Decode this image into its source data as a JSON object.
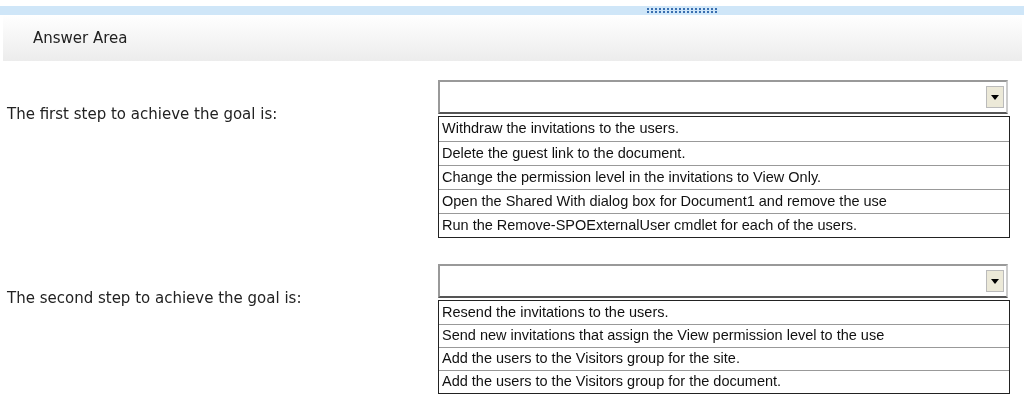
{
  "header": {
    "title": "Answer Area"
  },
  "questions": [
    {
      "label": "The first step to achieve the goal is:",
      "options": [
        "Withdraw the invitations to the users.",
        "Delete the guest link to the document.",
        "Change the permission level in the invitations to View Only.",
        "Open the Shared With dialog box for Document1 and remove the use",
        "Run the Remove-SPOExternalUser cmdlet for each of the users."
      ]
    },
    {
      "label": "The second step to achieve the goal is:",
      "options": [
        "Resend the invitations to the users.",
        "Send new invitations that assign the View permission level to the use",
        "Add the users to the Visitors group for the site.",
        "Add the users to the Visitors group for the document."
      ]
    }
  ]
}
